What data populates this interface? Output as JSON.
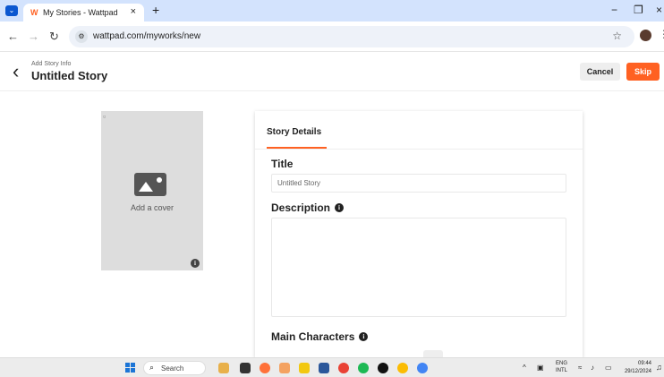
{
  "browser": {
    "tab_title": "My Stories - Wattpad",
    "tab_close": "×",
    "new_tab": "+",
    "url": "wattpad.com/myworks/new",
    "window_controls": {
      "minimize": "−",
      "restore": "❐",
      "close": "×"
    }
  },
  "header": {
    "subtitle": "Add Story Info",
    "title": "Untitled Story",
    "cancel_label": "Cancel",
    "skip_label": "Skip"
  },
  "cover": {
    "label": "Add a cover",
    "icon": "image-placeholder-icon"
  },
  "details": {
    "tab_label": "Story Details",
    "title_label": "Title",
    "title_placeholder": "Untitled Story",
    "description_label": "Description",
    "main_characters_label": "Main Characters"
  },
  "taskbar": {
    "search_label": "Search",
    "lang_top": "ENG",
    "lang_bottom": "INTL",
    "time": "09:44",
    "date": "29/12/2024"
  },
  "colors": {
    "accent": "#ff6122",
    "tabbar": "#d3e3fd"
  }
}
